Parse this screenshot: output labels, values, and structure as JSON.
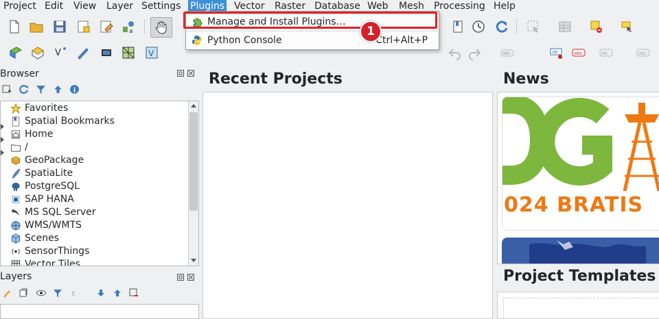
{
  "menubar": {
    "items": [
      "Project",
      "Edit",
      "View",
      "Layer",
      "Settings",
      "Plugins",
      "Vector",
      "Raster",
      "Database",
      "Web",
      "Mesh",
      "Processing",
      "Help"
    ],
    "active": "Plugins"
  },
  "plugins_menu": {
    "items": [
      {
        "label": "Manage and Install Plugins…",
        "shortcut": ""
      },
      {
        "label": "Python Console",
        "shortcut": "Ctrl+Alt+P"
      }
    ]
  },
  "annotation": {
    "step": "1",
    "color": "#e32129"
  },
  "browser": {
    "title": "Browser",
    "items": [
      "Favorites",
      "Spatial Bookmarks",
      "Home",
      "/",
      "GeoPackage",
      "SpatiaLite",
      "PostgreSQL",
      "SAP HANA",
      "MS SQL Server",
      "WMS/WMTS",
      "Scenes",
      "SensorThings",
      "Vector Tiles"
    ]
  },
  "layers": {
    "title": "Layers"
  },
  "main": {
    "recent_projects": "Recent Projects",
    "news": "News",
    "news_banner_text": "024 BRATIS",
    "project_templates": "Project Templates"
  },
  "colors": {
    "accent": "#3d8fd6",
    "qgis_green": "#6cb23e",
    "qgis_orange": "#ee7913",
    "highlight": "#e32129"
  }
}
